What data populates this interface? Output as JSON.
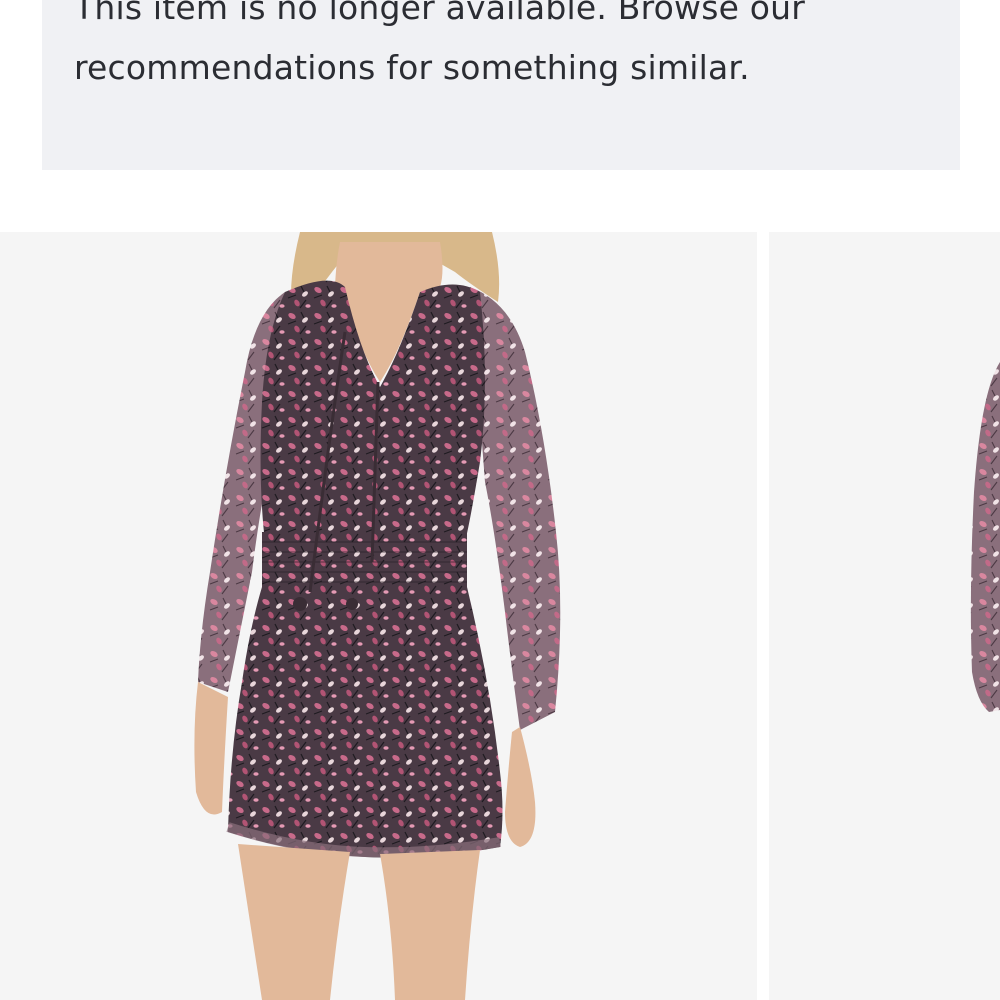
{
  "notice": {
    "message": "This item is no longer available. Browse our recommendations for something similar."
  },
  "gallery": {
    "images": [
      {
        "name": "product-photo-floral-dress-front"
      },
      {
        "name": "product-photo-floral-dress-side"
      }
    ]
  },
  "colors": {
    "banner_bg": "#f0f1f4",
    "text": "#2b2d33",
    "photo_bg": "#f5f5f5",
    "dress_base": "#4a3a45",
    "dress_print_pink": "#c86a8a",
    "hair": "#d8b88a",
    "skin": "#e2b99a"
  }
}
